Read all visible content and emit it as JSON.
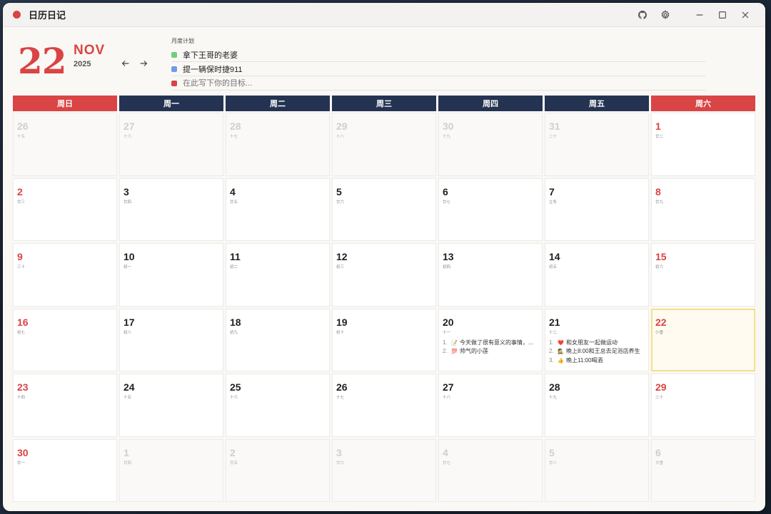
{
  "app": {
    "title": "日历日记",
    "accent": "#d94444",
    "navy": "#253352"
  },
  "header": {
    "day": "22",
    "month": "NOV",
    "year": "2025",
    "plan_title": "月度计划",
    "plans": [
      {
        "text": "拿下王哥的老婆",
        "color": "#6fd07a"
      },
      {
        "text": "提一辆保时捷911",
        "color": "#6f9be8"
      }
    ],
    "plan_placeholder": "在此写下你的目标...",
    "plan_placeholder_color": "#d94444"
  },
  "weekdays": [
    {
      "label": "周日",
      "weekend": true
    },
    {
      "label": "周一",
      "weekend": false
    },
    {
      "label": "周二",
      "weekend": false
    },
    {
      "label": "周三",
      "weekend": false
    },
    {
      "label": "周四",
      "weekend": false
    },
    {
      "label": "周五",
      "weekend": false
    },
    {
      "label": "周六",
      "weekend": true
    }
  ],
  "days": [
    {
      "day": "26",
      "lunar": "十五",
      "other": true
    },
    {
      "day": "27",
      "lunar": "十六",
      "other": true
    },
    {
      "day": "28",
      "lunar": "十七",
      "other": true
    },
    {
      "day": "29",
      "lunar": "十八",
      "other": true
    },
    {
      "day": "30",
      "lunar": "十九",
      "other": true
    },
    {
      "day": "31",
      "lunar": "二十",
      "other": true
    },
    {
      "day": "1",
      "lunar": "廿二"
    },
    {
      "day": "2",
      "lunar": "廿三"
    },
    {
      "day": "3",
      "lunar": "廿四"
    },
    {
      "day": "4",
      "lunar": "廿五"
    },
    {
      "day": "5",
      "lunar": "廿六"
    },
    {
      "day": "6",
      "lunar": "廿七"
    },
    {
      "day": "7",
      "lunar": "立冬"
    },
    {
      "day": "8",
      "lunar": "廿九"
    },
    {
      "day": "9",
      "lunar": "三十"
    },
    {
      "day": "10",
      "lunar": "初一"
    },
    {
      "day": "11",
      "lunar": "初二"
    },
    {
      "day": "12",
      "lunar": "初三"
    },
    {
      "day": "13",
      "lunar": "初四"
    },
    {
      "day": "14",
      "lunar": "初五"
    },
    {
      "day": "15",
      "lunar": "初六"
    },
    {
      "day": "16",
      "lunar": "初七"
    },
    {
      "day": "17",
      "lunar": "初八"
    },
    {
      "day": "18",
      "lunar": "初九"
    },
    {
      "day": "19",
      "lunar": "初十"
    },
    {
      "day": "20",
      "lunar": "十一",
      "events": [
        {
          "n": "1.",
          "emoji": "📝",
          "text": "今天做了很有意义的事情，..."
        },
        {
          "n": "2.",
          "emoji": "💯",
          "text": "帅气的小莲"
        }
      ]
    },
    {
      "day": "21",
      "lunar": "十二",
      "events": [
        {
          "n": "1.",
          "emoji": "❤️",
          "text": "和女朋友一起做运动"
        },
        {
          "n": "2.",
          "emoji": "🕵️",
          "text": "晚上8:00和王总去足浴店养生"
        },
        {
          "n": "3.",
          "emoji": "👍",
          "text": "晚上11:00喝酒"
        }
      ]
    },
    {
      "day": "22",
      "lunar": "小雪",
      "today": true
    },
    {
      "day": "23",
      "lunar": "十四"
    },
    {
      "day": "24",
      "lunar": "十五"
    },
    {
      "day": "25",
      "lunar": "十六"
    },
    {
      "day": "26",
      "lunar": "十七"
    },
    {
      "day": "27",
      "lunar": "十八"
    },
    {
      "day": "28",
      "lunar": "十九"
    },
    {
      "day": "29",
      "lunar": "二十"
    },
    {
      "day": "30",
      "lunar": "廿一"
    },
    {
      "day": "1",
      "lunar": "廿四",
      "other": true
    },
    {
      "day": "2",
      "lunar": "廿五",
      "other": true
    },
    {
      "day": "3",
      "lunar": "廿六",
      "other": true
    },
    {
      "day": "4",
      "lunar": "廿七",
      "other": true
    },
    {
      "day": "5",
      "lunar": "廿八",
      "other": true
    },
    {
      "day": "6",
      "lunar": "大雪",
      "other": true
    }
  ],
  "icons": [
    "github-icon",
    "gear-icon",
    "minimize-icon",
    "maximize-icon",
    "close-icon",
    "arrow-left-icon",
    "arrow-right-icon"
  ]
}
